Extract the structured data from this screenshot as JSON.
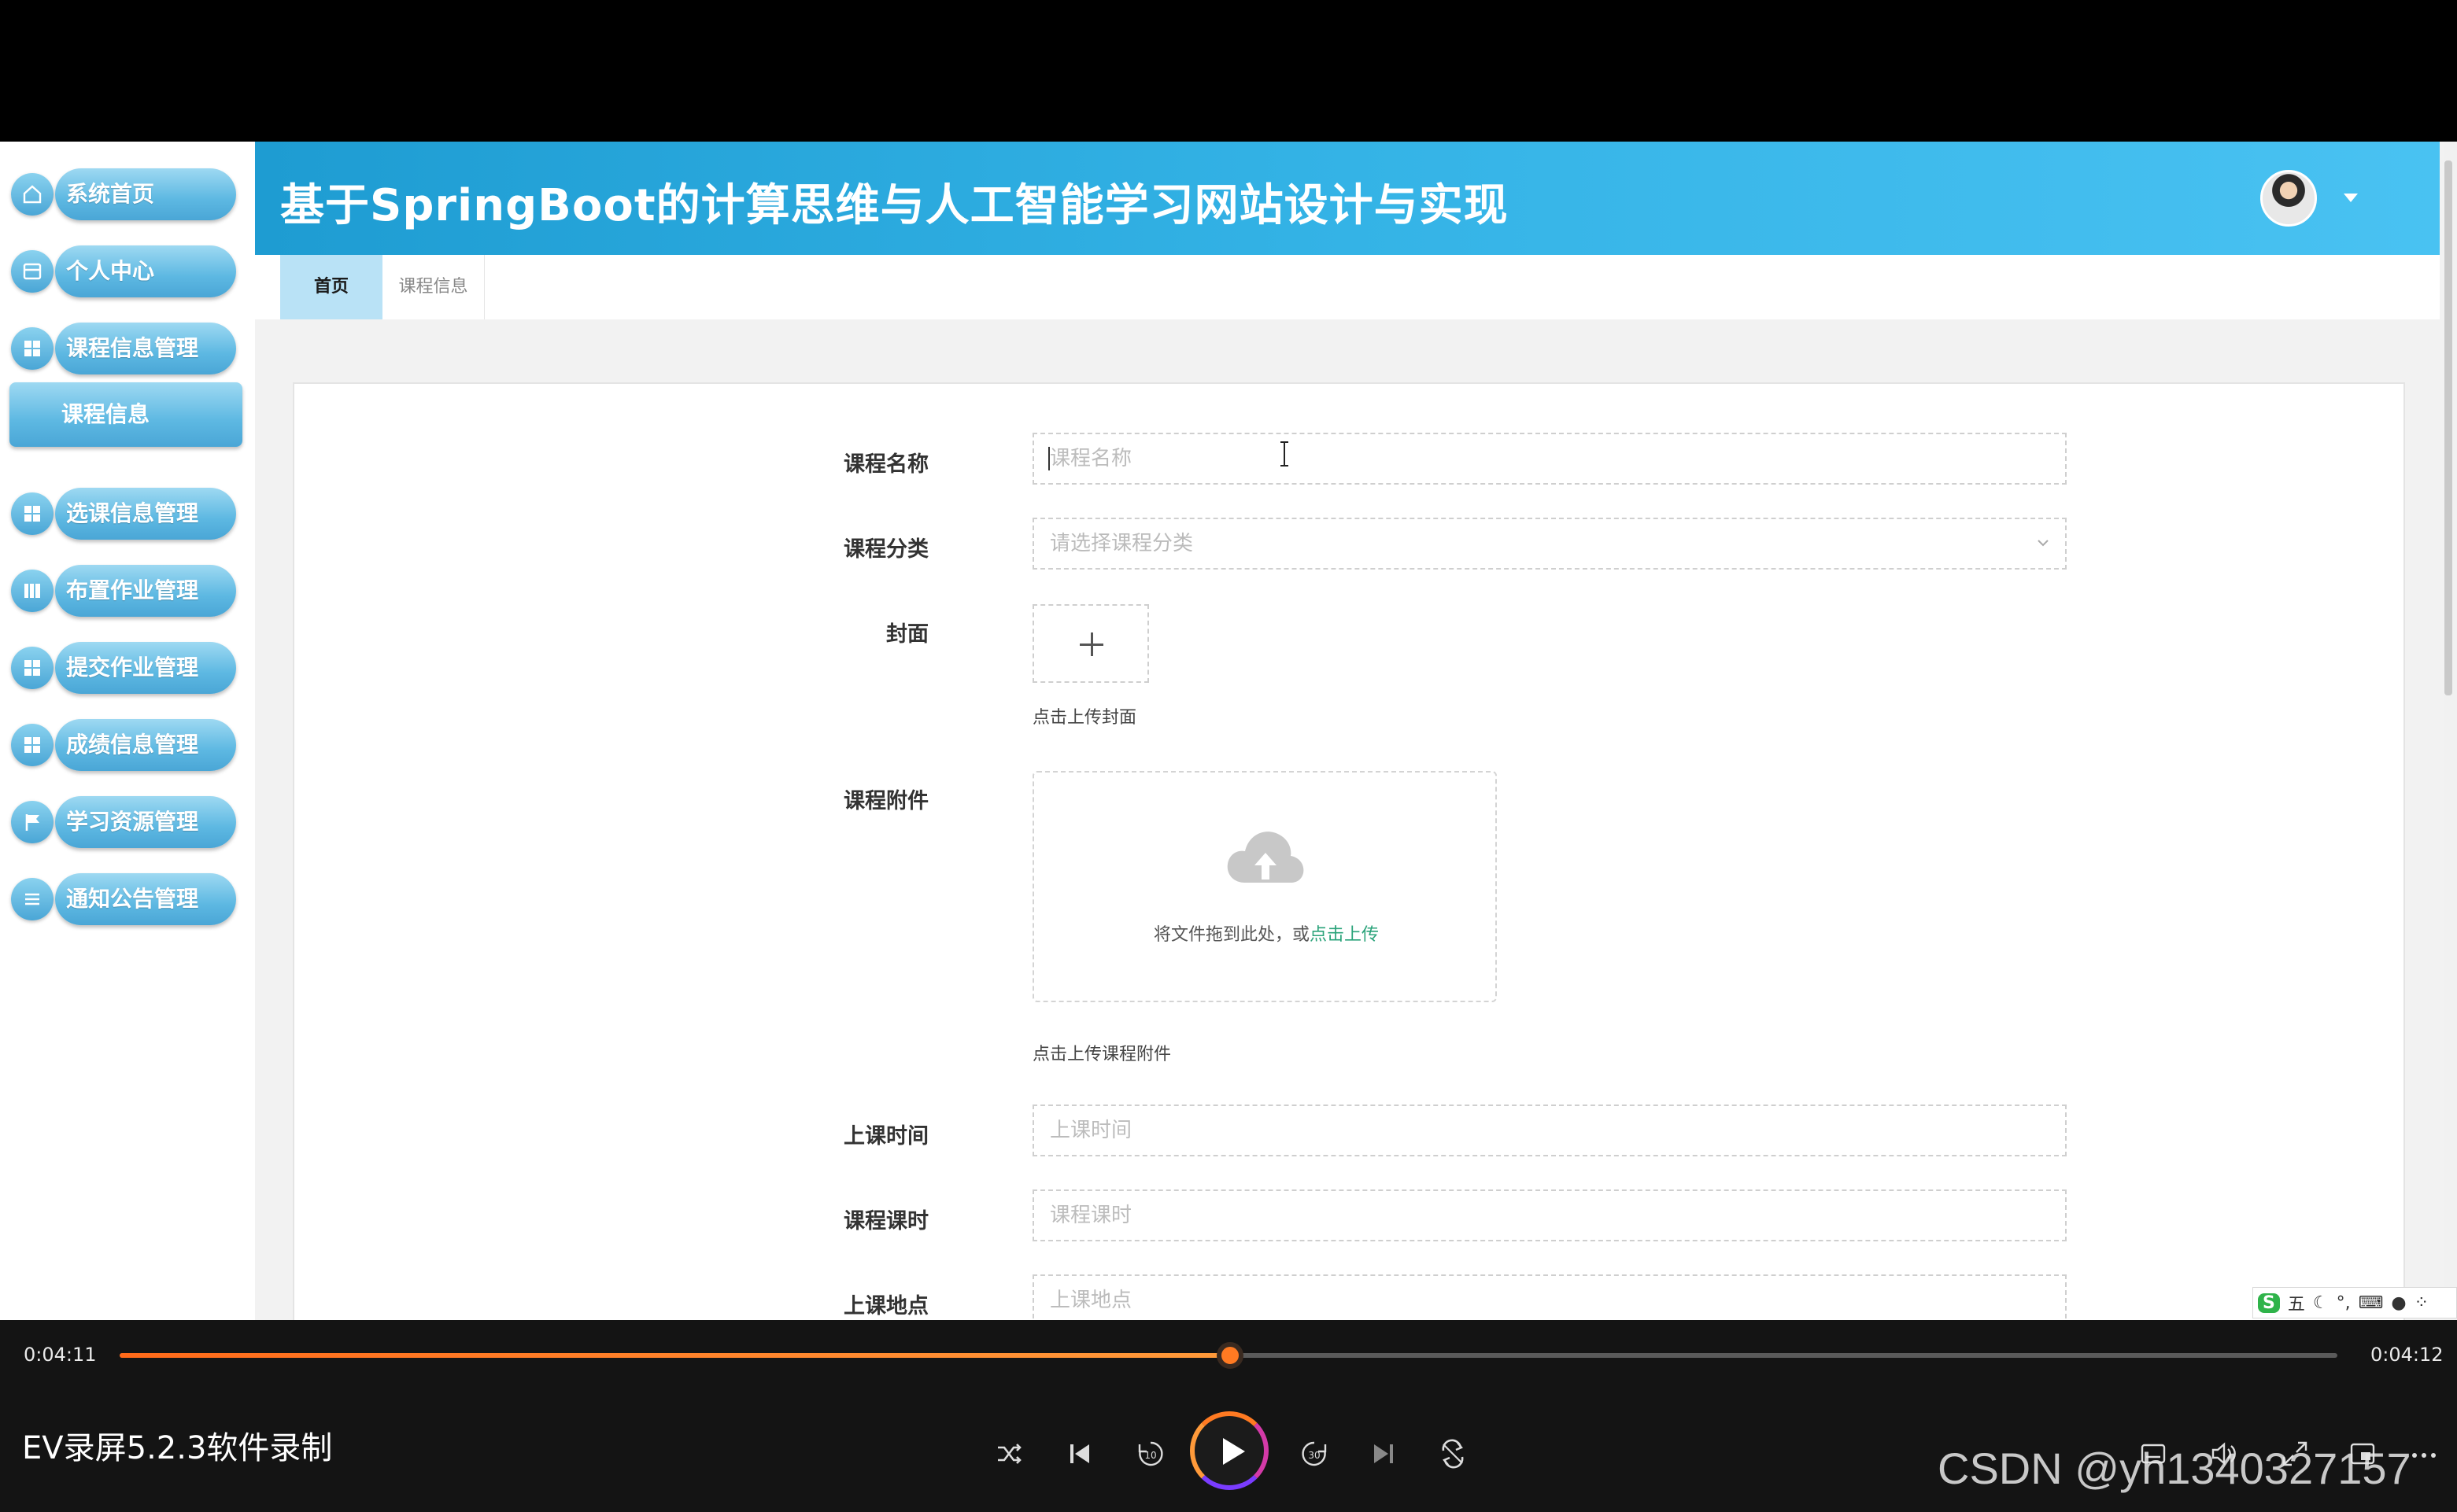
{
  "app": {
    "title": "基于SpringBoot的计算思维与人工智能学习网站设计与实现"
  },
  "sidebar": {
    "items": [
      {
        "label": "系统首页",
        "icon": "home-icon"
      },
      {
        "label": "个人中心",
        "icon": "card-icon"
      },
      {
        "label": "课程信息管理",
        "icon": "grid-icon"
      },
      {
        "label": "选课信息管理",
        "icon": "grid-icon"
      },
      {
        "label": "布置作业管理",
        "icon": "book-icon"
      },
      {
        "label": "提交作业管理",
        "icon": "grid-icon"
      },
      {
        "label": "成绩信息管理",
        "icon": "grid-icon"
      },
      {
        "label": "学习资源管理",
        "icon": "flag-icon"
      },
      {
        "label": "通知公告管理",
        "icon": "list-icon"
      }
    ],
    "sub_item": "课程信息"
  },
  "tabs": {
    "home": "首页",
    "course": "课程信息"
  },
  "form": {
    "course_name": {
      "label": "课程名称",
      "placeholder": "课程名称"
    },
    "course_category": {
      "label": "课程分类",
      "placeholder": "请选择课程分类"
    },
    "cover": {
      "label": "封面",
      "hint": "点击上传封面"
    },
    "attachment": {
      "label": "课程附件",
      "drop_text": "将文件拖到此处，或",
      "drop_link": "点击上传",
      "hint": "点击上传课程附件"
    },
    "class_time": {
      "label": "上课时间",
      "placeholder": "上课时间"
    },
    "class_hours": {
      "label": "课程课时",
      "placeholder": "课程课时"
    },
    "class_location": {
      "label": "上课地点",
      "placeholder": "上课地点"
    }
  },
  "ime": {
    "logo": "S",
    "mode": "五"
  },
  "player": {
    "current_time": "0:04:11",
    "total_time": "0:04:12",
    "progress": 0.5,
    "recorder_label": "EV录屏5.2.3软件录制",
    "watermark": "CSDN @yh1340327157"
  },
  "colors": {
    "header_start": "#1e9cd2",
    "header_end": "#49c2f2",
    "nav_pill": "#5db8e2",
    "progress": "#ff7a22",
    "upload_link": "#2aa37a"
  }
}
